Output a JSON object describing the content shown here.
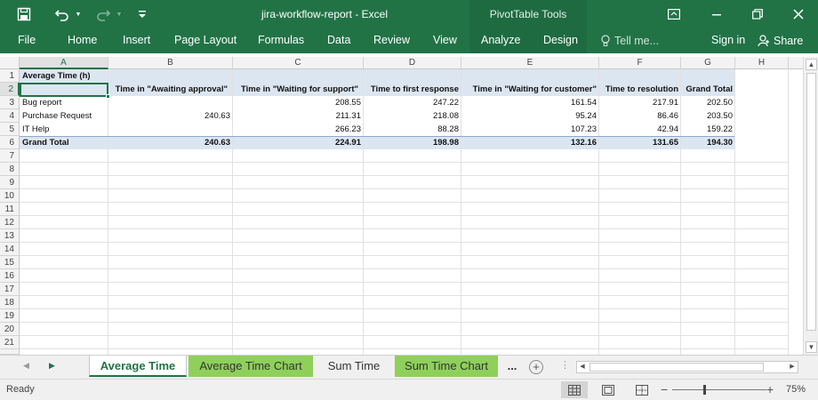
{
  "app": {
    "document_title": "jira-workflow-report - Excel",
    "contextual_tab_group": "PivotTable Tools",
    "icons": [
      "save-icon",
      "undo-icon",
      "redo-icon",
      "customize-qat-icon",
      "ribbon-display-icon",
      "minimize-icon",
      "restore-icon",
      "close-icon"
    ]
  },
  "ribbon": {
    "tabs": [
      "File",
      "Home",
      "Insert",
      "Page Layout",
      "Formulas",
      "Data",
      "Review",
      "View",
      "Analyze",
      "Design"
    ],
    "tell_me": "Tell me...",
    "sign_in": "Sign in",
    "share": "Share"
  },
  "grid": {
    "columns": [
      "A",
      "B",
      "C",
      "D",
      "E",
      "F",
      "G",
      "H"
    ],
    "rows": [
      "1",
      "2",
      "3",
      "4",
      "5",
      "6",
      "7",
      "8",
      "9",
      "10",
      "11",
      "12",
      "13",
      "14",
      "15",
      "16",
      "17",
      "18",
      "19",
      "20",
      "21"
    ],
    "selected_cell": "A2",
    "pivot": {
      "title": "Average Time (h)",
      "headers": [
        "Time in \"Awaiting approval\"",
        "Time in \"Waiting for support\"",
        "Time to first response",
        "Time in \"Waiting for customer\"",
        "Time to resolution",
        "Grand Total"
      ],
      "rows": [
        {
          "label": "Bug report",
          "values": [
            "",
            "208.55",
            "247.22",
            "161.54",
            "217.91",
            "202.50"
          ]
        },
        {
          "label": "Purchase Request",
          "values": [
            "240.63",
            "211.31",
            "218.08",
            "95.24",
            "86.46",
            "203.50"
          ]
        },
        {
          "label": "IT Help",
          "values": [
            "",
            "266.23",
            "88.28",
            "107.23",
            "42.94",
            "159.22"
          ]
        }
      ],
      "total": {
        "label": "Grand Total",
        "values": [
          "240.63",
          "224.91",
          "198.98",
          "132.16",
          "131.65",
          "194.30"
        ]
      }
    }
  },
  "sheet_tabs": {
    "tabs": [
      "Average Time",
      "Average Time Chart",
      "Sum Time",
      "Sum Time Chart"
    ],
    "active": "Average Time",
    "more": "..."
  },
  "status_bar": {
    "status": "Ready",
    "zoom_level": "75%"
  }
}
